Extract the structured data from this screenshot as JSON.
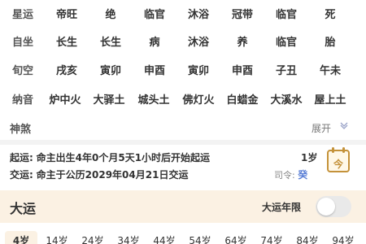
{
  "grid": {
    "rows": [
      [
        "星运",
        "帝旺",
        "绝",
        "临官",
        "沐浴",
        "冠带",
        "临官",
        "死"
      ],
      [
        "自坐",
        "长生",
        "长生",
        "病",
        "沐浴",
        "养",
        "临官",
        "胎"
      ],
      [
        "旬空",
        "戌亥",
        "寅卯",
        "申酉",
        "寅卯",
        "申酉",
        "子丑",
        "午未"
      ],
      [
        "纳音",
        "炉中火",
        "大驿土",
        "城头土",
        "佛灯火",
        "白蜡金",
        "大溪水",
        "屋上土"
      ]
    ]
  },
  "shensha": {
    "title": "神煞",
    "expand_label": "展开"
  },
  "qiyun": {
    "qiyun_label": "起运:",
    "qiyun_text": "命主出生4年0个月5天1小时后开始起运",
    "age": "1岁",
    "jiaoyun_label": "交运:",
    "jiaoyun_text": "命主于公历2029年04月21日交运",
    "siling_label": "司令:",
    "siling_value": "癸",
    "calendar_char": "今"
  },
  "dayun": {
    "title": "大运",
    "year_limit_label": "大运年限",
    "toggle_on": false,
    "ages": [
      "4岁",
      "14岁",
      "24岁",
      "34岁",
      "44岁",
      "54岁",
      "64岁",
      "74岁",
      "84岁",
      "94岁"
    ]
  },
  "colors": {
    "accent": "#c4923a",
    "highlight_bg": "#fbf1e3",
    "siling": "#5a7fd6"
  }
}
